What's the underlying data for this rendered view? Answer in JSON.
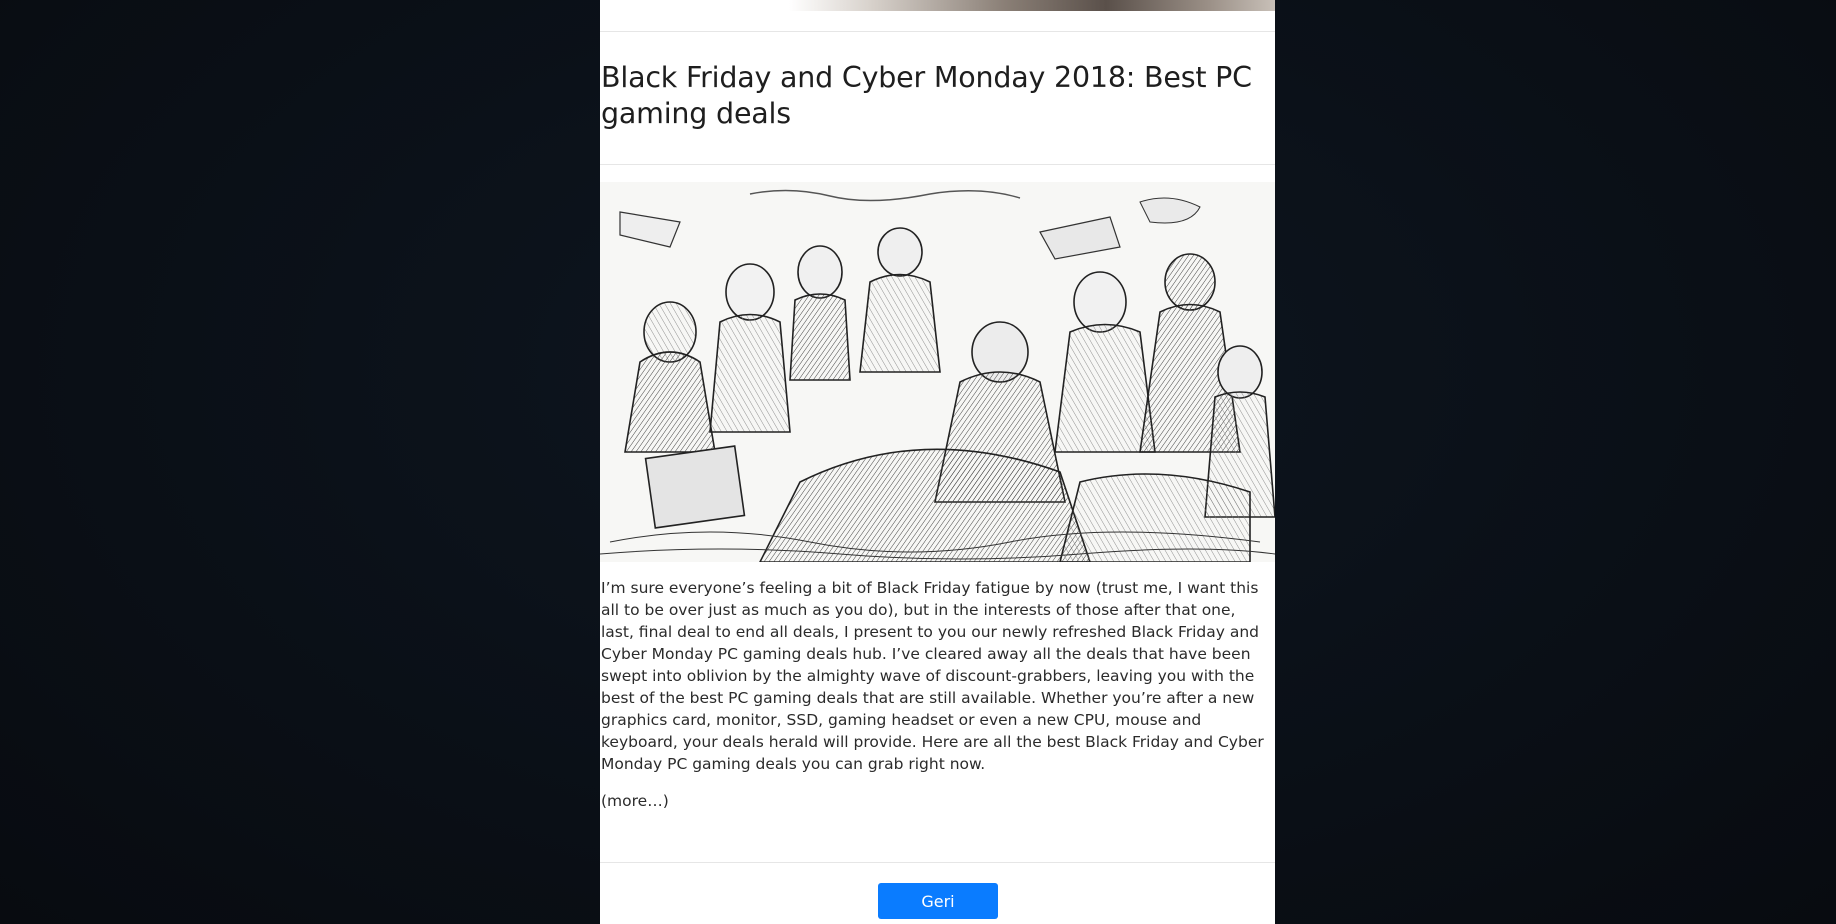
{
  "article": {
    "title": "Black Friday and Cyber Monday 2018: Best PC gaming deals",
    "image_alt": "Black-and-white engraving of a frantic crowd scrambling over sale goods",
    "body": "I’m sure everyone’s feeling a bit of Black Friday fatigue by now (trust me, I want this all to be over just as much as you do), but in the interests of those after that one, last, final deal to end all deals, I present to you our newly refreshed Black Friday and Cyber Monday PC gaming deals hub. I’ve cleared away all the deals that have been swept into oblivion by the almighty wave of discount-grabbers, leaving you with the best of the best PC gaming deals that are still available. Whether you’re after a new graphics card, monitor, SSD, gaming headset or even a new CPU, mouse and keyboard, your deals herald will provide. Here are all the best Black Friday and Cyber Monday PC gaming deals you can grab right now.",
    "more_label": "(more…)"
  },
  "footer": {
    "back_label": "Geri"
  },
  "colors": {
    "page_background": "#0b1119",
    "card_background": "#ffffff",
    "button_accent": "#0a7cff",
    "text": "#2b2b2b"
  }
}
